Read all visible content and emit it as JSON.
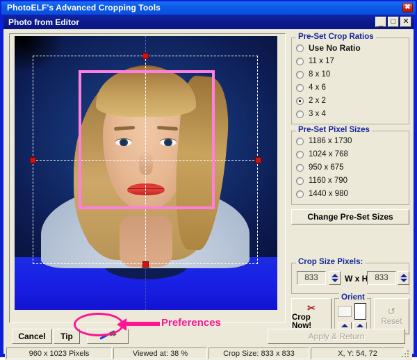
{
  "window": {
    "outer_title": "PhotoELF's Advanced Cropping Tools",
    "outer_close": "✖",
    "inner_title": "Photo from Editor",
    "minimize": "_",
    "maximize": "□",
    "close": "✕"
  },
  "panel": {
    "crop_ratios": {
      "title": "Pre-Set Crop Ratios",
      "options": [
        {
          "label": "Use No Ratio",
          "selected": false,
          "bold": true
        },
        {
          "label": "11 x 17",
          "selected": false,
          "bold": false
        },
        {
          "label": "8 x 10",
          "selected": false,
          "bold": false
        },
        {
          "label": "4 x 6",
          "selected": false,
          "bold": false
        },
        {
          "label": "2 x 2",
          "selected": true,
          "bold": false
        },
        {
          "label": "3 x 4",
          "selected": false,
          "bold": false
        }
      ]
    },
    "pixel_sizes": {
      "title": "Pre-Set Pixel Sizes",
      "options": [
        {
          "label": "1186 x 1730",
          "selected": false
        },
        {
          "label": "1024 x 768",
          "selected": false
        },
        {
          "label": "950 x 675",
          "selected": false
        },
        {
          "label": "1160 x 790",
          "selected": false
        },
        {
          "label": "1440 x 980",
          "selected": false
        }
      ]
    },
    "change_presets_label": "Change Pre-Set Sizes",
    "crop_size": {
      "title": "Crop Size Pixels:",
      "width_value": "833",
      "height_value": "833",
      "separator": "W x H"
    },
    "crop_now_label": "Crop Now!",
    "crop_now_icon": "✂",
    "orient": {
      "title": "Orient",
      "landscape_label": "",
      "portrait_label": ""
    },
    "reset_label": "Reset",
    "reset_icon": "↺"
  },
  "actions": {
    "cancel": "Cancel",
    "tip": "Tip",
    "preferences_icon": "hammer-icon",
    "apply": "Apply & Return"
  },
  "annotation": {
    "text": "Preferences",
    "color": "#ff1493"
  },
  "status": {
    "dimensions": "960 x 1023 Pixels",
    "zoom": "Viewed at: 38 %",
    "crop_size": "Crop Size: 833 x 833",
    "coords": "X, Y: 54, 72"
  },
  "colors": {
    "outer_titlebar": "#0a5ae8",
    "inner_titlebar": "#0b1a8c",
    "face_panel": "#ece9d8",
    "group_title": "#14249c",
    "crop_rect": "#ff7fe0",
    "handle": "#d41010",
    "annotation": "#ff1493"
  }
}
